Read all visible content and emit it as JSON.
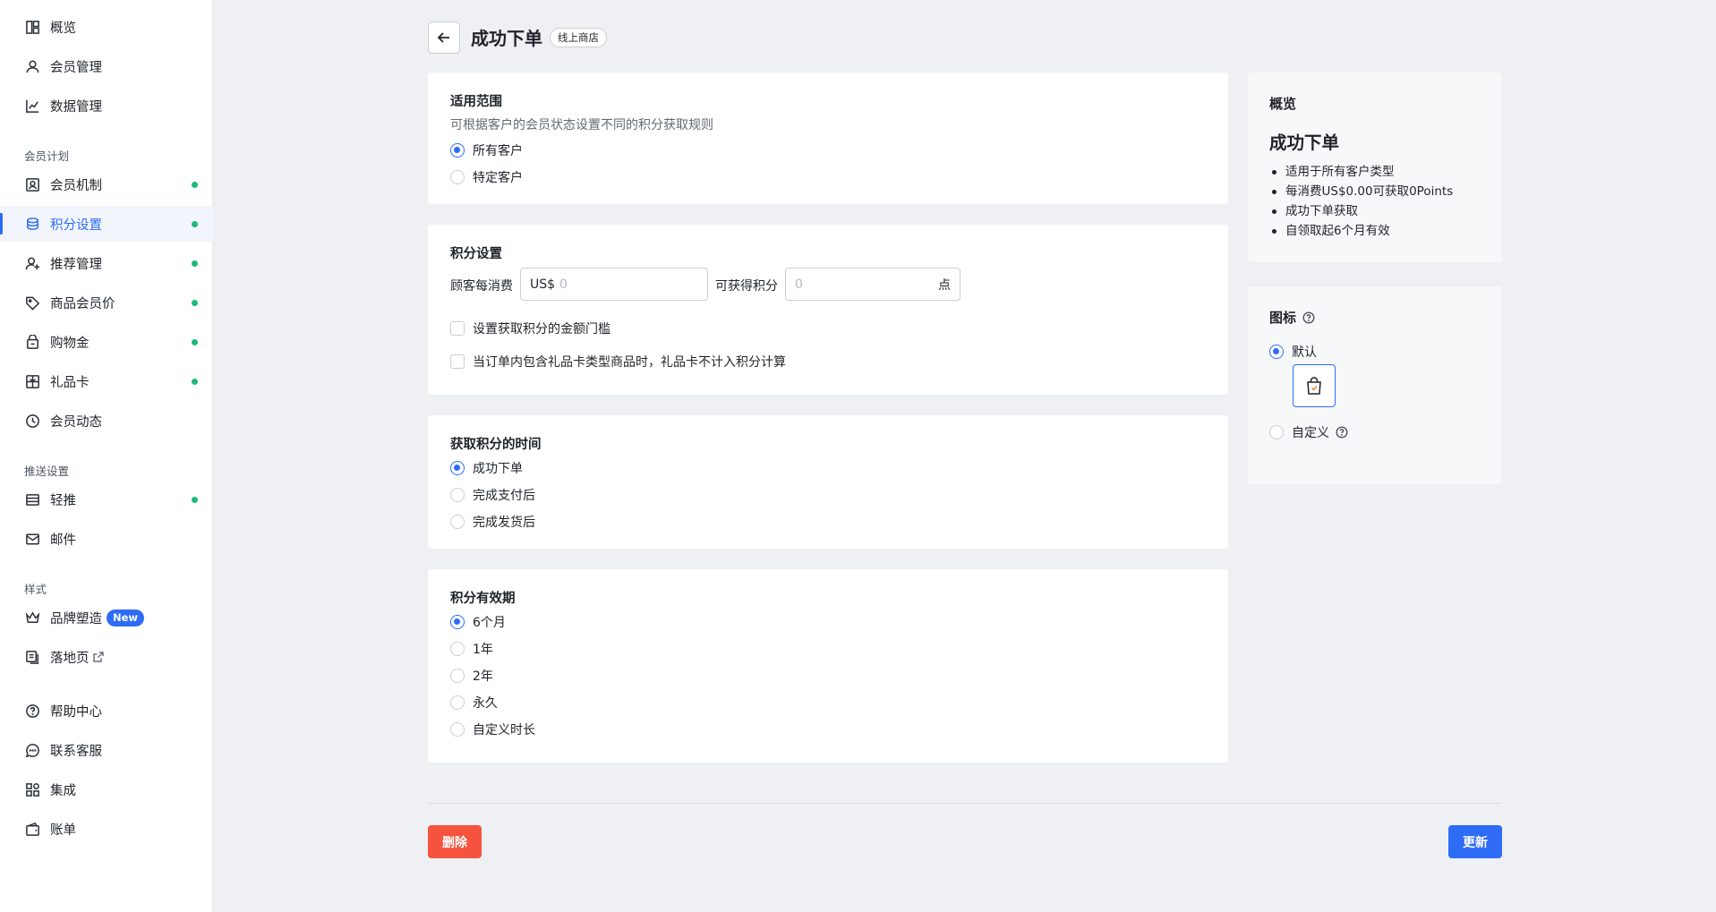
{
  "sidebar": {
    "items": [
      {
        "label": "概览",
        "icon": "dashboard-icon"
      },
      {
        "label": "会员管理",
        "icon": "user-icon"
      },
      {
        "label": "数据管理",
        "icon": "chart-icon"
      },
      {
        "label": "会员机制",
        "icon": "member-card-icon",
        "dot": true
      },
      {
        "label": "积分设置",
        "icon": "coins-icon",
        "dot": true,
        "active": true
      },
      {
        "label": "推荐管理",
        "icon": "user-plus-icon",
        "dot": true
      },
      {
        "label": "商品会员价",
        "icon": "tag-icon",
        "dot": true
      },
      {
        "label": "购物金",
        "icon": "wallet-icon",
        "dot": true
      },
      {
        "label": "礼品卡",
        "icon": "gift-card-icon",
        "dot": true
      },
      {
        "label": "会员动态",
        "icon": "clock-icon"
      },
      {
        "label": "轻推",
        "icon": "layout-icon",
        "dot": true
      },
      {
        "label": "邮件",
        "icon": "mail-icon"
      },
      {
        "label": "品牌塑造",
        "icon": "crown-icon",
        "badge": "New"
      },
      {
        "label": "落地页",
        "icon": "pages-icon",
        "external": true
      },
      {
        "label": "帮助中心",
        "icon": "help-icon"
      },
      {
        "label": "联系客服",
        "icon": "chat-icon"
      },
      {
        "label": "集成",
        "icon": "apps-icon"
      },
      {
        "label": "账单",
        "icon": "bill-icon"
      }
    ],
    "groups": [
      "会员计划",
      "推送设置",
      "样式"
    ]
  },
  "header": {
    "title": "成功下单",
    "tag": "线上商店"
  },
  "scope": {
    "title": "适用范围",
    "desc": "可根据客户的会员状态设置不同的积分获取规则",
    "options": [
      "所有客户",
      "特定客户"
    ],
    "selected": 0
  },
  "points": {
    "title": "积分设置",
    "spend_label": "顾客每消费",
    "currency_prefix": "US$",
    "spend_placeholder": "0",
    "earn_label": "可获得积分",
    "earn_placeholder": "0",
    "earn_suffix": "点",
    "checkboxes": [
      "设置获取积分的金额门槛",
      "当订单内包含礼品卡类型商品时，礼品卡不计入积分计算"
    ]
  },
  "timing": {
    "title": "获取积分的时间",
    "options": [
      "成功下单",
      "完成支付后",
      "完成发货后"
    ],
    "selected": 0
  },
  "validity": {
    "title": "积分有效期",
    "options": [
      "6个月",
      "1年",
      "2年",
      "永久",
      "自定义时长"
    ],
    "selected": 0
  },
  "overview": {
    "title": "概览",
    "name": "成功下单",
    "bullets": [
      "适用于所有客户类型",
      "每消费US$0.00可获取0Points",
      "成功下单获取",
      "自领取起6个月有效"
    ]
  },
  "icon_setting": {
    "title": "图标",
    "options": [
      "默认",
      "自定义"
    ],
    "selected": 0,
    "preview_icon": "shopping-bag-icon"
  },
  "actions": {
    "delete_label": "删除",
    "update_label": "更新"
  },
  "colors": {
    "primary": "#2e6cf6",
    "danger": "#f5533d",
    "status_dot": "#1fb87a"
  }
}
